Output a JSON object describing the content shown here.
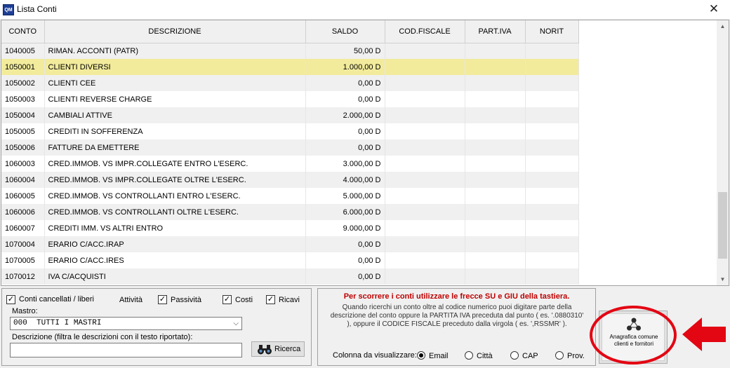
{
  "window": {
    "title": "Lista Conti",
    "icon_text": "QM"
  },
  "table": {
    "headers": [
      "CONTO",
      "DESCRIZIONE",
      "SALDO",
      "COD.FISCALE",
      "PART.IVA",
      "NORIT"
    ],
    "rows": [
      {
        "conto": "1040005",
        "descrizione": "RIMAN. ACCONTI (PATR)",
        "saldo": "50,00 D"
      },
      {
        "conto": "1050001",
        "descrizione": "CLIENTI DIVERSI",
        "saldo": "1.000,00 D",
        "selected": true
      },
      {
        "conto": "1050002",
        "descrizione": "CLIENTI CEE",
        "saldo": "0,00 D"
      },
      {
        "conto": "1050003",
        "descrizione": "CLIENTI REVERSE CHARGE",
        "saldo": "0,00 D"
      },
      {
        "conto": "1050004",
        "descrizione": "CAMBIALI ATTIVE",
        "saldo": "2.000,00 D"
      },
      {
        "conto": "1050005",
        "descrizione": "CREDITI IN SOFFERENZA",
        "saldo": "0,00 D"
      },
      {
        "conto": "1050006",
        "descrizione": "FATTURE DA EMETTERE",
        "saldo": "0,00 D"
      },
      {
        "conto": "1060003",
        "descrizione": "CRED.IMMOB. VS IMPR.COLLEGATE ENTRO L'ESERC.",
        "saldo": "3.000,00 D"
      },
      {
        "conto": "1060004",
        "descrizione": "CRED.IMMOB. VS IMPR.COLLEGATE OLTRE L'ESERC.",
        "saldo": "4.000,00 D"
      },
      {
        "conto": "1060005",
        "descrizione": "CRED.IMMOB. VS CONTROLLANTI ENTRO L'ESERC.",
        "saldo": "5.000,00 D"
      },
      {
        "conto": "1060006",
        "descrizione": "CRED.IMMOB. VS CONTROLLANTI OLTRE L'ESERC.",
        "saldo": "6.000,00 D"
      },
      {
        "conto": "1060007",
        "descrizione": "CREDITI IMM. VS ALTRI ENTRO",
        "saldo": "9.000,00 D"
      },
      {
        "conto": "1070004",
        "descrizione": "ERARIO C/ACC.IRAP",
        "saldo": "0,00 D"
      },
      {
        "conto": "1070005",
        "descrizione": "ERARIO C/ACC.IRES",
        "saldo": "0,00 D"
      },
      {
        "conto": "1070012",
        "descrizione": "IVA C/ACQUISTI",
        "saldo": "0,00 D"
      }
    ]
  },
  "filters": {
    "conti_cancellati_label": "Conti cancellati / liberi",
    "conti_cancellati_checked": true,
    "attivita_label": "Attività",
    "passivita_label": "Passività",
    "passivita_checked": true,
    "costi_label": "Costi",
    "costi_checked": true,
    "ricavi_label": "Ricavi",
    "ricavi_checked": true,
    "mastro_label": "Mastro:",
    "mastro_value": "000  TUTTI I MASTRI",
    "descrizione_label": "Descrizione (filtra le descrizioni con il testo riportato):",
    "descrizione_value": "",
    "search_label": "Ricerca"
  },
  "info": {
    "heading": "Per scorrere i conti utilizzare le frecce SU e GIU della tastiera.",
    "body": "Quando ricerchi un conto oltre al codice numerico puoi digitare parte della descrizione del conto oppure la PARTITA IVA preceduta dal punto ( es. '.0880310' ), oppure il CODICE FISCALE preceduto dalla virgola ( es. ',RSSMR' ).",
    "colonna_label": "Colonna da visualizzare:",
    "options": [
      "Email",
      "Città",
      "CAP",
      "Prov."
    ],
    "selected_option": "Email"
  },
  "anagrafica_button": {
    "label": "Anagrafica comune clienti e fornitori"
  },
  "colors": {
    "selected_row": "#f2eb9c",
    "info_heading": "#c00000",
    "annotation_red": "#e30613"
  }
}
